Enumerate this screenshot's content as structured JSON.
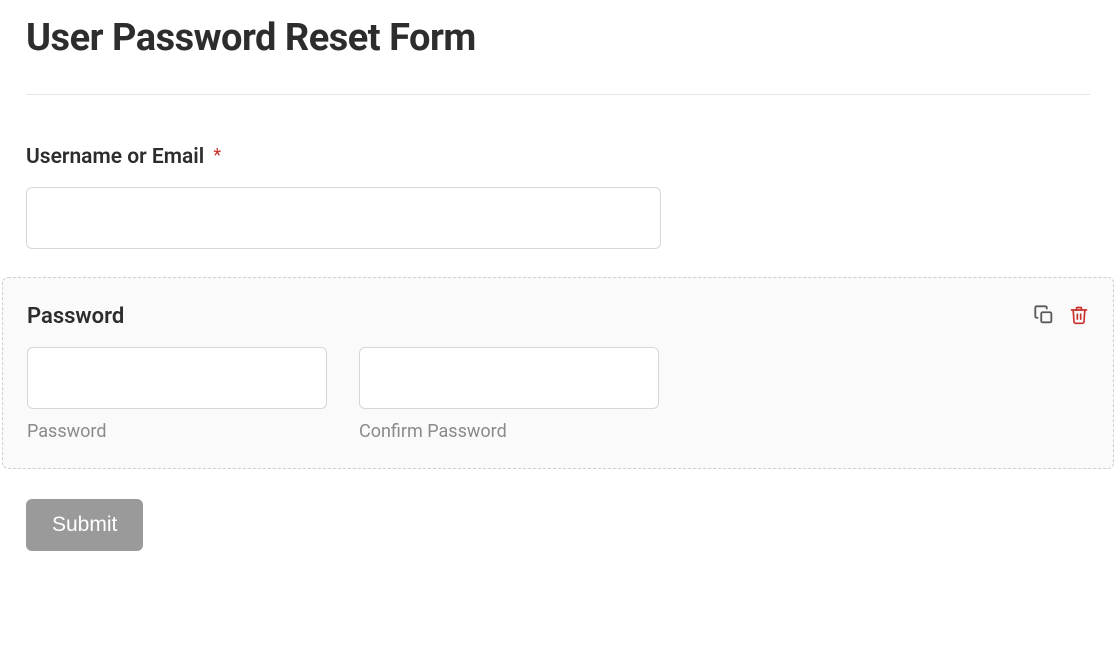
{
  "form": {
    "title": "User Password Reset Form",
    "fields": {
      "username": {
        "label": "Username or Email",
        "required_marker": "*",
        "value": ""
      },
      "password_panel": {
        "title": "Password",
        "password": {
          "value": "",
          "sublabel": "Password"
        },
        "confirm": {
          "value": "",
          "sublabel": "Confirm Password"
        }
      }
    },
    "submit_label": "Submit"
  },
  "icons": {
    "duplicate": "duplicate-icon",
    "delete": "trash-icon"
  },
  "colors": {
    "required": "#c9302c",
    "trash": "#c9302c",
    "duplicate": "#5a5a5a",
    "submit_bg": "#9a9a9a"
  }
}
